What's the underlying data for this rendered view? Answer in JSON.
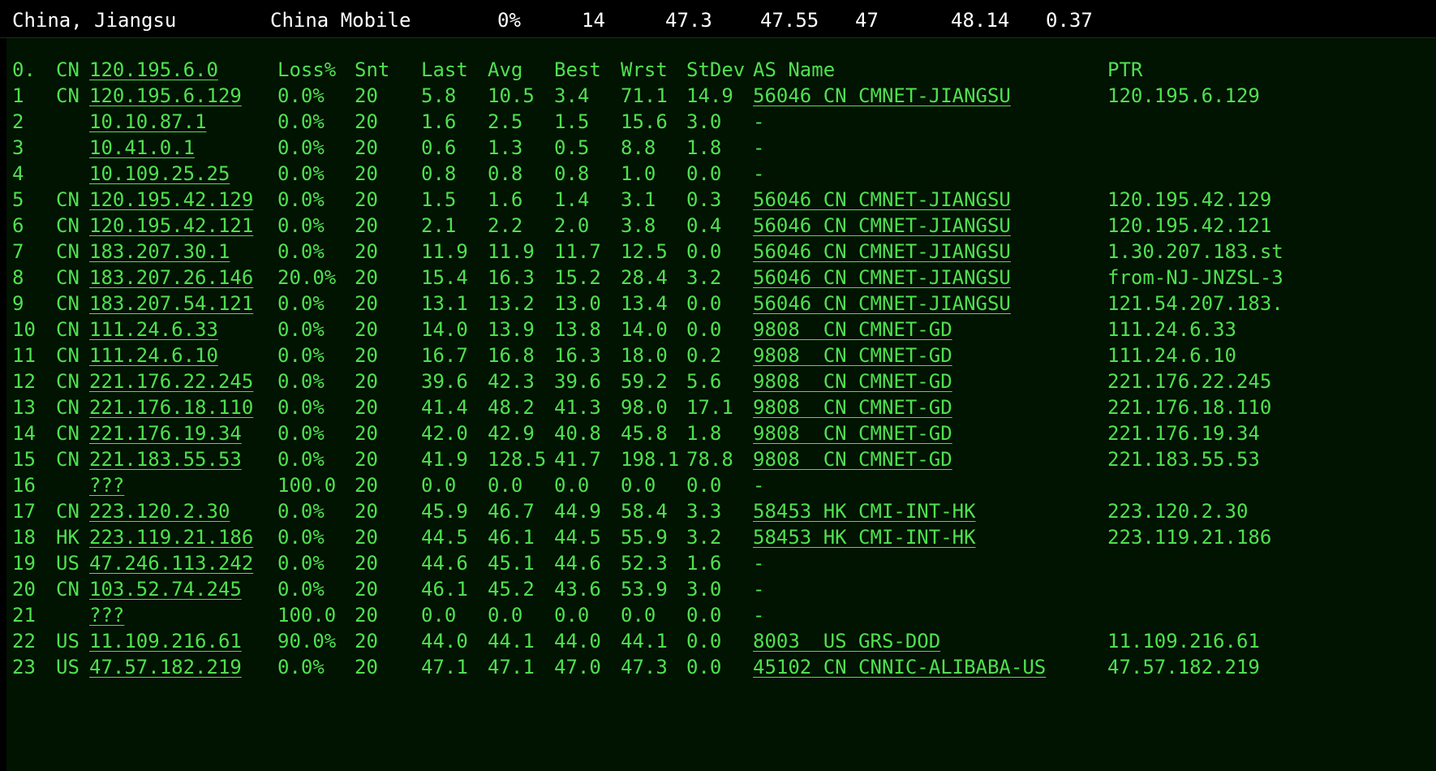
{
  "summary": {
    "location": "China, Jiangsu",
    "isp": "China Mobile",
    "loss": "0%",
    "sent": "14",
    "last": "47.3",
    "avg": "47.55",
    "best": "47",
    "worst": "48.14",
    "stdev": "0.37"
  },
  "table": {
    "header": {
      "hop": "0.",
      "cc": "CN",
      "host": "120.195.6.0",
      "loss": "Loss%",
      "snt": "Snt",
      "last": "Last",
      "avg": "Avg",
      "best": "Best",
      "wrst": "Wrst",
      "stdev": "StDev",
      "asname": "AS Name",
      "ptr": "PTR"
    },
    "rows": [
      {
        "hop": "1",
        "cc": "CN",
        "host": "120.195.6.129",
        "loss": "0.0%",
        "snt": "20",
        "last": "5.8",
        "avg": "10.5",
        "best": "3.4",
        "wrst": "71.1",
        "stdev": "14.9",
        "as": "56046 CN CMNET-JIANGSU",
        "ptr": "120.195.6.129"
      },
      {
        "hop": "2",
        "cc": "",
        "host": "10.10.87.1",
        "loss": "0.0%",
        "snt": "20",
        "last": "1.6",
        "avg": "2.5",
        "best": "1.5",
        "wrst": "15.6",
        "stdev": "3.0",
        "as": "-",
        "ptr": ""
      },
      {
        "hop": "3",
        "cc": "",
        "host": "10.41.0.1",
        "loss": "0.0%",
        "snt": "20",
        "last": "0.6",
        "avg": "1.3",
        "best": "0.5",
        "wrst": "8.8",
        "stdev": "1.8",
        "as": "-",
        "ptr": ""
      },
      {
        "hop": "4",
        "cc": "",
        "host": "10.109.25.25",
        "loss": "0.0%",
        "snt": "20",
        "last": "0.8",
        "avg": "0.8",
        "best": "0.8",
        "wrst": "1.0",
        "stdev": "0.0",
        "as": "-",
        "ptr": ""
      },
      {
        "hop": "5",
        "cc": "CN",
        "host": "120.195.42.129",
        "loss": "0.0%",
        "snt": "20",
        "last": "1.5",
        "avg": "1.6",
        "best": "1.4",
        "wrst": "3.1",
        "stdev": "0.3",
        "as": "56046 CN CMNET-JIANGSU",
        "ptr": "120.195.42.129"
      },
      {
        "hop": "6",
        "cc": "CN",
        "host": "120.195.42.121",
        "loss": "0.0%",
        "snt": "20",
        "last": "2.1",
        "avg": "2.2",
        "best": "2.0",
        "wrst": "3.8",
        "stdev": "0.4",
        "as": "56046 CN CMNET-JIANGSU",
        "ptr": "120.195.42.121"
      },
      {
        "hop": "7",
        "cc": "CN",
        "host": "183.207.30.1",
        "loss": "0.0%",
        "snt": "20",
        "last": "11.9",
        "avg": "11.9",
        "best": "11.7",
        "wrst": "12.5",
        "stdev": "0.0",
        "as": "56046 CN CMNET-JIANGSU",
        "ptr": "1.30.207.183.st"
      },
      {
        "hop": "8",
        "cc": "CN",
        "host": "183.207.26.146",
        "loss": "20.0%",
        "snt": "20",
        "last": "15.4",
        "avg": "16.3",
        "best": "15.2",
        "wrst": "28.4",
        "stdev": "3.2",
        "as": "56046 CN CMNET-JIANGSU",
        "ptr": "from-NJ-JNZSL-3"
      },
      {
        "hop": "9",
        "cc": "CN",
        "host": "183.207.54.121",
        "loss": "0.0%",
        "snt": "20",
        "last": "13.1",
        "avg": "13.2",
        "best": "13.0",
        "wrst": "13.4",
        "stdev": "0.0",
        "as": "56046 CN CMNET-JIANGSU",
        "ptr": "121.54.207.183."
      },
      {
        "hop": "10",
        "cc": "CN",
        "host": "111.24.6.33",
        "loss": "0.0%",
        "snt": "20",
        "last": "14.0",
        "avg": "13.9",
        "best": "13.8",
        "wrst": "14.0",
        "stdev": "0.0",
        "as": "9808  CN CMNET-GD",
        "ptr": "111.24.6.33"
      },
      {
        "hop": "11",
        "cc": "CN",
        "host": "111.24.6.10",
        "loss": "0.0%",
        "snt": "20",
        "last": "16.7",
        "avg": "16.8",
        "best": "16.3",
        "wrst": "18.0",
        "stdev": "0.2",
        "as": "9808  CN CMNET-GD",
        "ptr": "111.24.6.10"
      },
      {
        "hop": "12",
        "cc": "CN",
        "host": "221.176.22.245",
        "loss": "0.0%",
        "snt": "20",
        "last": "39.6",
        "avg": "42.3",
        "best": "39.6",
        "wrst": "59.2",
        "stdev": "5.6",
        "as": "9808  CN CMNET-GD",
        "ptr": "221.176.22.245"
      },
      {
        "hop": "13",
        "cc": "CN",
        "host": "221.176.18.110",
        "loss": "0.0%",
        "snt": "20",
        "last": "41.4",
        "avg": "48.2",
        "best": "41.3",
        "wrst": "98.0",
        "stdev": "17.1",
        "as": "9808  CN CMNET-GD",
        "ptr": "221.176.18.110"
      },
      {
        "hop": "14",
        "cc": "CN",
        "host": "221.176.19.34",
        "loss": "0.0%",
        "snt": "20",
        "last": "42.0",
        "avg": "42.9",
        "best": "40.8",
        "wrst": "45.8",
        "stdev": "1.8",
        "as": "9808  CN CMNET-GD",
        "ptr": "221.176.19.34"
      },
      {
        "hop": "15",
        "cc": "CN",
        "host": "221.183.55.53",
        "loss": "0.0%",
        "snt": "20",
        "last": "41.9",
        "avg": "128.5",
        "best": "41.7",
        "wrst": "198.1",
        "stdev": "78.8",
        "as": "9808  CN CMNET-GD",
        "ptr": "221.183.55.53"
      },
      {
        "hop": "16",
        "cc": "",
        "host": "???",
        "loss": "100.0",
        "snt": "20",
        "last": "0.0",
        "avg": "0.0",
        "best": "0.0",
        "wrst": "0.0",
        "stdev": "0.0",
        "as": "-",
        "ptr": ""
      },
      {
        "hop": "17",
        "cc": "CN",
        "host": "223.120.2.30",
        "loss": "0.0%",
        "snt": "20",
        "last": "45.9",
        "avg": "46.7",
        "best": "44.9",
        "wrst": "58.4",
        "stdev": "3.3",
        "as": "58453 HK CMI-INT-HK",
        "ptr": "223.120.2.30"
      },
      {
        "hop": "18",
        "cc": "HK",
        "host": "223.119.21.186",
        "loss": "0.0%",
        "snt": "20",
        "last": "44.5",
        "avg": "46.1",
        "best": "44.5",
        "wrst": "55.9",
        "stdev": "3.2",
        "as": "58453 HK CMI-INT-HK",
        "ptr": "223.119.21.186"
      },
      {
        "hop": "19",
        "cc": "US",
        "host": "47.246.113.242",
        "loss": "0.0%",
        "snt": "20",
        "last": "44.6",
        "avg": "45.1",
        "best": "44.6",
        "wrst": "52.3",
        "stdev": "1.6",
        "as": "-",
        "ptr": ""
      },
      {
        "hop": "20",
        "cc": "CN",
        "host": "103.52.74.245",
        "loss": "0.0%",
        "snt": "20",
        "last": "46.1",
        "avg": "45.2",
        "best": "43.6",
        "wrst": "53.9",
        "stdev": "3.0",
        "as": "-",
        "ptr": ""
      },
      {
        "hop": "21",
        "cc": "",
        "host": "???",
        "loss": "100.0",
        "snt": "20",
        "last": "0.0",
        "avg": "0.0",
        "best": "0.0",
        "wrst": "0.0",
        "stdev": "0.0",
        "as": "-",
        "ptr": ""
      },
      {
        "hop": "22",
        "cc": "US",
        "host": "11.109.216.61",
        "loss": "90.0%",
        "snt": "20",
        "last": "44.0",
        "avg": "44.1",
        "best": "44.0",
        "wrst": "44.1",
        "stdev": "0.0",
        "as": "8003  US GRS-DOD",
        "ptr": "11.109.216.61"
      },
      {
        "hop": "23",
        "cc": "US",
        "host": "47.57.182.219",
        "loss": "0.0%",
        "snt": "20",
        "last": "47.1",
        "avg": "47.1",
        "best": "47.0",
        "wrst": "47.3",
        "stdev": "0.0",
        "as": "45102 CN CNNIC-ALIBABA-US",
        "ptr": "47.57.182.219"
      }
    ]
  },
  "colors": {
    "summary_bg": "#000000",
    "summary_text": "#ffffff",
    "panel_bg": "#011301",
    "terminal_green": "#4fe14f"
  }
}
